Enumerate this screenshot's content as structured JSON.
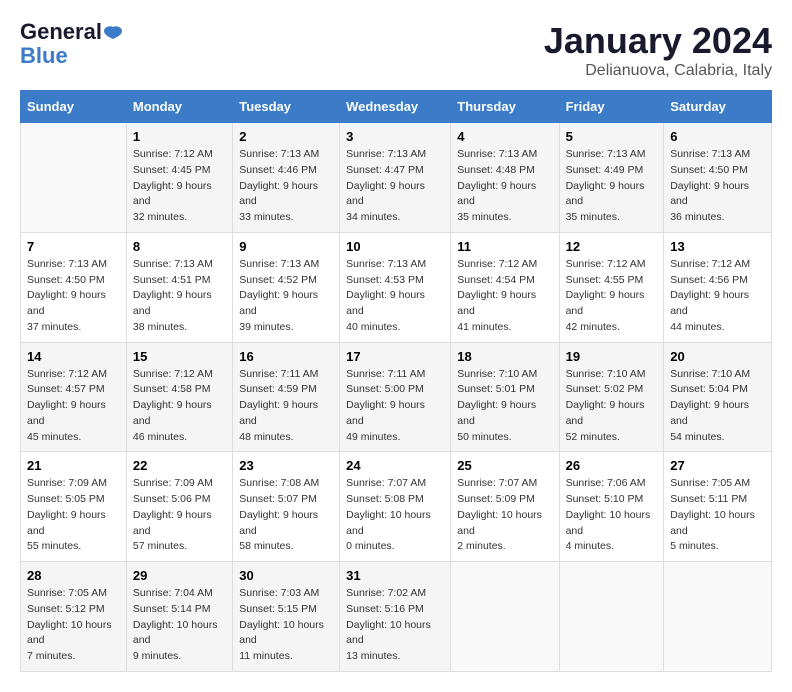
{
  "header": {
    "logo_line1": "General",
    "logo_line2": "Blue",
    "title": "January 2024",
    "location": "Delianuova, Calabria, Italy"
  },
  "days_of_week": [
    "Sunday",
    "Monday",
    "Tuesday",
    "Wednesday",
    "Thursday",
    "Friday",
    "Saturday"
  ],
  "weeks": [
    [
      {
        "day": null
      },
      {
        "day": 1,
        "sunrise": "7:12 AM",
        "sunset": "4:45 PM",
        "daylight": "9 hours and 32 minutes."
      },
      {
        "day": 2,
        "sunrise": "7:13 AM",
        "sunset": "4:46 PM",
        "daylight": "9 hours and 33 minutes."
      },
      {
        "day": 3,
        "sunrise": "7:13 AM",
        "sunset": "4:47 PM",
        "daylight": "9 hours and 34 minutes."
      },
      {
        "day": 4,
        "sunrise": "7:13 AM",
        "sunset": "4:48 PM",
        "daylight": "9 hours and 35 minutes."
      },
      {
        "day": 5,
        "sunrise": "7:13 AM",
        "sunset": "4:49 PM",
        "daylight": "9 hours and 35 minutes."
      },
      {
        "day": 6,
        "sunrise": "7:13 AM",
        "sunset": "4:50 PM",
        "daylight": "9 hours and 36 minutes."
      }
    ],
    [
      {
        "day": 7,
        "sunrise": "7:13 AM",
        "sunset": "4:50 PM",
        "daylight": "9 hours and 37 minutes."
      },
      {
        "day": 8,
        "sunrise": "7:13 AM",
        "sunset": "4:51 PM",
        "daylight": "9 hours and 38 minutes."
      },
      {
        "day": 9,
        "sunrise": "7:13 AM",
        "sunset": "4:52 PM",
        "daylight": "9 hours and 39 minutes."
      },
      {
        "day": 10,
        "sunrise": "7:13 AM",
        "sunset": "4:53 PM",
        "daylight": "9 hours and 40 minutes."
      },
      {
        "day": 11,
        "sunrise": "7:12 AM",
        "sunset": "4:54 PM",
        "daylight": "9 hours and 41 minutes."
      },
      {
        "day": 12,
        "sunrise": "7:12 AM",
        "sunset": "4:55 PM",
        "daylight": "9 hours and 42 minutes."
      },
      {
        "day": 13,
        "sunrise": "7:12 AM",
        "sunset": "4:56 PM",
        "daylight": "9 hours and 44 minutes."
      }
    ],
    [
      {
        "day": 14,
        "sunrise": "7:12 AM",
        "sunset": "4:57 PM",
        "daylight": "9 hours and 45 minutes."
      },
      {
        "day": 15,
        "sunrise": "7:12 AM",
        "sunset": "4:58 PM",
        "daylight": "9 hours and 46 minutes."
      },
      {
        "day": 16,
        "sunrise": "7:11 AM",
        "sunset": "4:59 PM",
        "daylight": "9 hours and 48 minutes."
      },
      {
        "day": 17,
        "sunrise": "7:11 AM",
        "sunset": "5:00 PM",
        "daylight": "9 hours and 49 minutes."
      },
      {
        "day": 18,
        "sunrise": "7:10 AM",
        "sunset": "5:01 PM",
        "daylight": "9 hours and 50 minutes."
      },
      {
        "day": 19,
        "sunrise": "7:10 AM",
        "sunset": "5:02 PM",
        "daylight": "9 hours and 52 minutes."
      },
      {
        "day": 20,
        "sunrise": "7:10 AM",
        "sunset": "5:04 PM",
        "daylight": "9 hours and 54 minutes."
      }
    ],
    [
      {
        "day": 21,
        "sunrise": "7:09 AM",
        "sunset": "5:05 PM",
        "daylight": "9 hours and 55 minutes."
      },
      {
        "day": 22,
        "sunrise": "7:09 AM",
        "sunset": "5:06 PM",
        "daylight": "9 hours and 57 minutes."
      },
      {
        "day": 23,
        "sunrise": "7:08 AM",
        "sunset": "5:07 PM",
        "daylight": "9 hours and 58 minutes."
      },
      {
        "day": 24,
        "sunrise": "7:07 AM",
        "sunset": "5:08 PM",
        "daylight": "10 hours and 0 minutes."
      },
      {
        "day": 25,
        "sunrise": "7:07 AM",
        "sunset": "5:09 PM",
        "daylight": "10 hours and 2 minutes."
      },
      {
        "day": 26,
        "sunrise": "7:06 AM",
        "sunset": "5:10 PM",
        "daylight": "10 hours and 4 minutes."
      },
      {
        "day": 27,
        "sunrise": "7:05 AM",
        "sunset": "5:11 PM",
        "daylight": "10 hours and 5 minutes."
      }
    ],
    [
      {
        "day": 28,
        "sunrise": "7:05 AM",
        "sunset": "5:12 PM",
        "daylight": "10 hours and 7 minutes."
      },
      {
        "day": 29,
        "sunrise": "7:04 AM",
        "sunset": "5:14 PM",
        "daylight": "10 hours and 9 minutes."
      },
      {
        "day": 30,
        "sunrise": "7:03 AM",
        "sunset": "5:15 PM",
        "daylight": "10 hours and 11 minutes."
      },
      {
        "day": 31,
        "sunrise": "7:02 AM",
        "sunset": "5:16 PM",
        "daylight": "10 hours and 13 minutes."
      },
      {
        "day": null
      },
      {
        "day": null
      },
      {
        "day": null
      }
    ]
  ],
  "labels": {
    "sunrise": "Sunrise:",
    "sunset": "Sunset:",
    "daylight": "Daylight:"
  }
}
